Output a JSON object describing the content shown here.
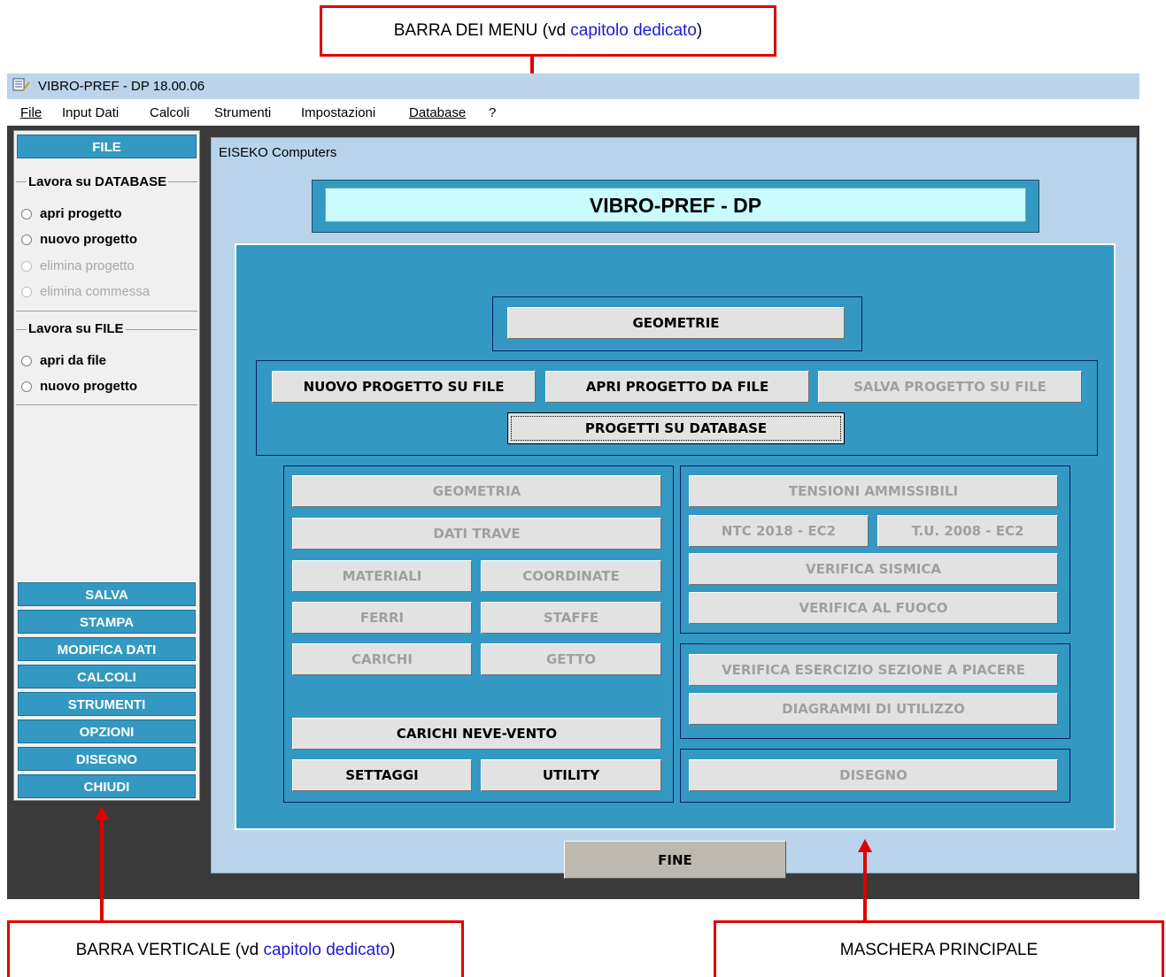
{
  "callouts": {
    "menu_bar": {
      "prefix": "BARRA DEI MENU (vd ",
      "link": "capitolo dedicato",
      "suffix": ")"
    },
    "vertical_bar": {
      "prefix": "BARRA VERTICALE (vd ",
      "link": "capitolo dedicato",
      "suffix": ")"
    },
    "main_mask": {
      "text": "MASCHERA PRINCIPALE"
    }
  },
  "window": {
    "title": "VIBRO-PREF - DP 18.00.06"
  },
  "menu": [
    "File",
    "Input Dati",
    "Calcoli",
    "Strumenti",
    "Impostazioni",
    "Database",
    "?"
  ],
  "sidebar": {
    "header": "FILE",
    "database_group": {
      "title": "Lavora su DATABASE",
      "options": [
        {
          "label": "apri progetto",
          "enabled": true
        },
        {
          "label": "nuovo progetto",
          "enabled": true
        },
        {
          "label": "elimina progetto",
          "enabled": false
        },
        {
          "label": "elimina commessa",
          "enabled": false
        }
      ]
    },
    "file_group": {
      "title": "Lavora su FILE",
      "options": [
        {
          "label": "apri da file",
          "enabled": true
        },
        {
          "label": "nuovo progetto",
          "enabled": true
        }
      ]
    },
    "buttons": [
      "SALVA",
      "STAMPA",
      "MODIFICA DATI",
      "CALCOLI",
      "STRUMENTI",
      "OPZIONI",
      "DISEGNO",
      "CHIUDI"
    ]
  },
  "form": {
    "title": "EISEKO Computers",
    "banner": "VIBRO-PREF - DP",
    "buttons": {
      "geometrie": "GEOMETRIE",
      "nuovo_file": "NUOVO PROGETTO SU FILE",
      "apri_file": "APRI PROGETTO DA FILE",
      "salva_file": "SALVA PROGETTO SU FILE",
      "progetti_db": "PROGETTI SU DATABASE",
      "geometria": "GEOMETRIA",
      "dati_trave": "DATI TRAVE",
      "materiali": "MATERIALI",
      "coordinate": "COORDINATE",
      "ferri": "FERRI",
      "staffe": "STAFFE",
      "carichi": "CARICHI",
      "getto": "GETTO",
      "carichi_neve": "CARICHI NEVE-VENTO",
      "settaggi": "SETTAGGI",
      "utility": "UTILITY",
      "tensioni": "TENSIONI AMMISSIBILI",
      "ntc": "NTC 2018 - EC2",
      "tu": "T.U. 2008 - EC2",
      "sismica": "VERIFICA SISMICA",
      "fuoco": "VERIFICA AL FUOCO",
      "esercizio": "VERIFICA ESERCIZIO SEZIONE A PIACERE",
      "diagrammi": "DIAGRAMMI DI UTILIZZO",
      "disegno": "DISEGNO",
      "fine": "FINE"
    }
  }
}
